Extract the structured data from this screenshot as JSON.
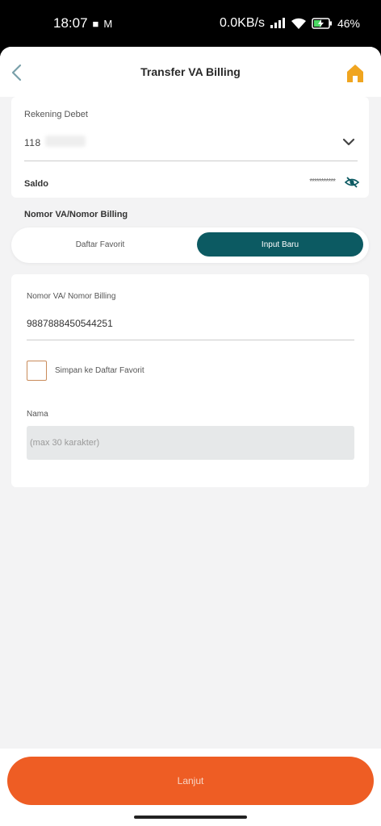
{
  "status_bar": {
    "time": "18:07",
    "net_speed": "0.0KB/s",
    "battery": "46%",
    "icons": [
      "video-icon",
      "mail-icon",
      "signal-icon",
      "wifi-icon",
      "battery-charging-icon"
    ]
  },
  "header": {
    "title": "Transfer VA Billing",
    "back_icon": "chevron-left-icon",
    "home_icon": "home-icon"
  },
  "account": {
    "label": "Rekening Debet",
    "value": "118",
    "saldo_label": "Saldo",
    "saldo_value": "***********"
  },
  "section_label": "Nomor VA/Nomor Billing",
  "tabs": {
    "favorite": "Daftar Favorit",
    "new_input": "Input Baru",
    "active": "Input Baru"
  },
  "form": {
    "va_label": "Nomor VA/ Nomor Billing",
    "va_value": "9887888450544251",
    "save_favorite_label": "Simpan ke Daftar Favorit",
    "save_favorite_checked": false,
    "name_label": "Nama",
    "name_placeholder": "(max 30 karakter)"
  },
  "submit_label": "Lanjut",
  "colors": {
    "accent": "#0c5a62",
    "primary_button": "#ee5d24",
    "home_icon": "#f0a520",
    "checkbox_border": "#c98b5a"
  }
}
